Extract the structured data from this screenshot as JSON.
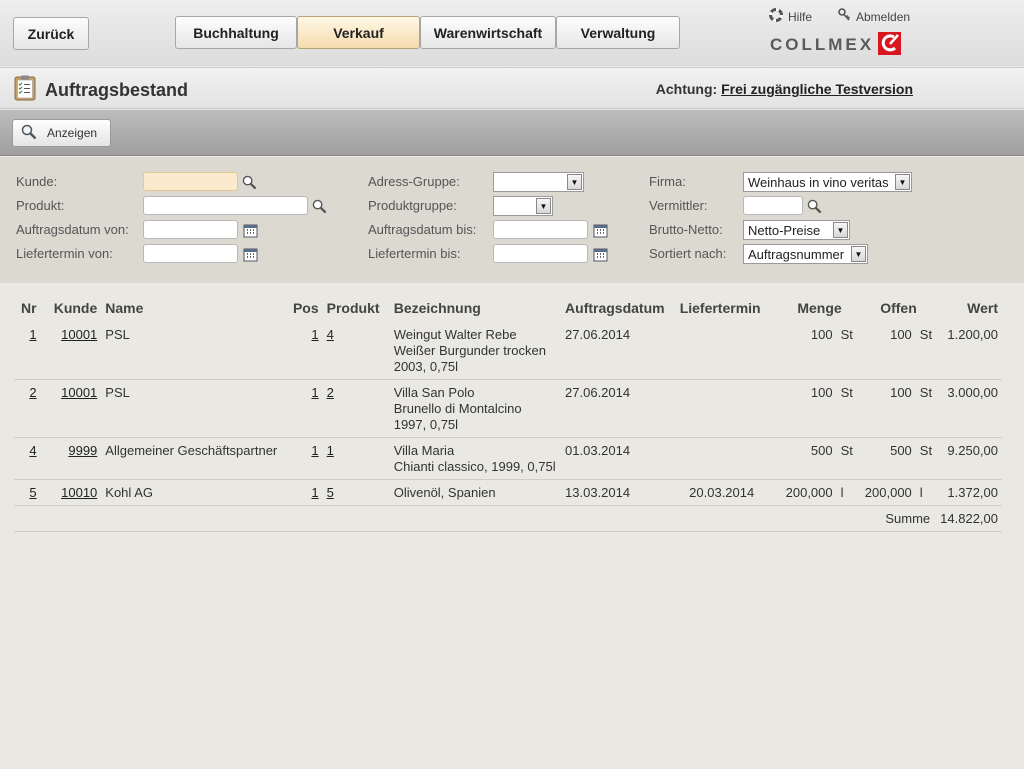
{
  "nav": {
    "back": "Zurück",
    "tabs": [
      {
        "label": "Buchhaltung",
        "active": false
      },
      {
        "label": "Verkauf",
        "active": true
      },
      {
        "label": "Warenwirtschaft",
        "active": false
      },
      {
        "label": "Verwaltung",
        "active": false
      }
    ],
    "help": "Hilfe",
    "logout": "Abmelden",
    "logo": "COLLMEX"
  },
  "header": {
    "title": "Auftragsbestand",
    "warning_prefix": "Achtung:",
    "warning_link": "Frei zugängliche Testversion"
  },
  "toolbar": {
    "show": "Anzeigen"
  },
  "filters": {
    "customer_label": "Kunde:",
    "product_label": "Produkt:",
    "order_date_from_label": "Auftragsdatum von:",
    "delivery_from_label": "Liefertermin von:",
    "address_group_label": "Adress-Gruppe:",
    "product_group_label": "Produktgruppe:",
    "order_date_to_label": "Auftragsdatum bis:",
    "delivery_to_label": "Liefertermin bis:",
    "company_label": "Firma:",
    "company_value": "Weinhaus in vino veritas",
    "agent_label": "Vermittler:",
    "gross_net_label": "Brutto-Netto:",
    "gross_net_value": "Netto-Preise",
    "sort_label": "Sortiert nach:",
    "sort_value": "Auftragsnummer"
  },
  "table": {
    "headers": {
      "nr": "Nr",
      "customer": "Kunde",
      "name": "Name",
      "pos": "Pos",
      "product": "Produkt",
      "description": "Bezeichnung",
      "order_date": "Auftragsdatum",
      "delivery": "Liefertermin",
      "quantity": "Menge",
      "open": "Offen",
      "value": "Wert"
    },
    "rows": [
      {
        "nr": "1",
        "customer": "10001",
        "name": "PSL",
        "pos": "1",
        "product": "4",
        "desc1": "Weingut Walter Rebe",
        "desc2": "Weißer Burgunder trocken",
        "desc3": "2003, 0,75l",
        "order_date": "27.06.2014",
        "delivery": "",
        "qty": "100",
        "qty_unit": "St",
        "open": "100",
        "open_unit": "St",
        "value": "1.200,00"
      },
      {
        "nr": "2",
        "customer": "10001",
        "name": "PSL",
        "pos": "1",
        "product": "2",
        "desc1": "Villa San Polo",
        "desc2": "Brunello di Montalcino",
        "desc3": "1997, 0,75l",
        "order_date": "27.06.2014",
        "delivery": "",
        "qty": "100",
        "qty_unit": "St",
        "open": "100",
        "open_unit": "St",
        "value": "3.000,00"
      },
      {
        "nr": "4",
        "customer": "9999",
        "name": "Allgemeiner Geschäftspartner",
        "pos": "1",
        "product": "1",
        "desc1": "Villa Maria",
        "desc2": "Chianti classico, 1999, 0,75l",
        "desc3": "",
        "order_date": "01.03.2014",
        "delivery": "",
        "qty": "500",
        "qty_unit": "St",
        "open": "500",
        "open_unit": "St",
        "value": "9.250,00"
      },
      {
        "nr": "5",
        "customer": "10010",
        "name": "Kohl AG",
        "pos": "1",
        "product": "5",
        "desc1": "Olivenöl, Spanien",
        "desc2": "",
        "desc3": "",
        "order_date": "13.03.2014",
        "delivery": "20.03.2014",
        "qty": "200,000",
        "qty_unit": "l",
        "open": "200,000",
        "open_unit": "l",
        "value": "1.372,00"
      }
    ],
    "sum_label": "Summe",
    "sum_value": "14.822,00"
  }
}
